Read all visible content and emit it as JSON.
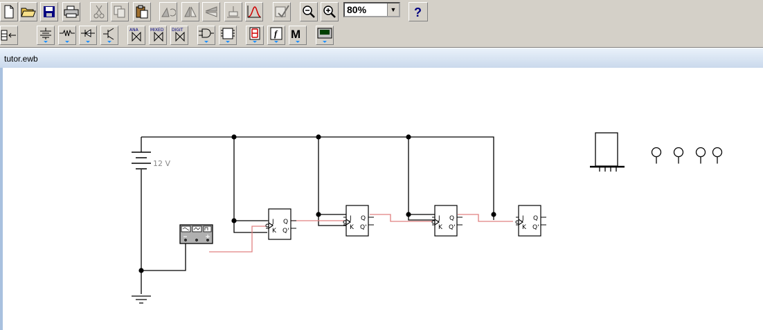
{
  "toolbar_main": {
    "zoom_value": "80%",
    "buttons": [
      "new-icon",
      "open-icon",
      "save-icon",
      "print-icon",
      "cut-icon",
      "copy-icon",
      "paste-icon",
      "rotate-icon",
      "flip-horizontal-icon",
      "flip-vertical-icon",
      "subcircuit-icon",
      "graph-icon",
      "component-properties-icon",
      "zoom-out-icon",
      "zoom-in-icon",
      "help-icon"
    ]
  },
  "toolbar_parts": {
    "m_label": "M",
    "f_label": "f",
    "ana_label": "ANA",
    "mixed_label": "MIXED",
    "digit_label": "DIGIT"
  },
  "window": {
    "title": "tutor.ewb"
  },
  "circuit": {
    "battery_label": "12 V",
    "flipflops": [
      {
        "j": "J",
        "k": "K",
        "q": "Q",
        "qn": "Q'"
      },
      {
        "j": "J",
        "k": "K",
        "q": "Q",
        "qn": "Q'"
      },
      {
        "j": "J",
        "k": "K",
        "q": "Q",
        "qn": "Q'"
      },
      {
        "j": "J",
        "k": "K",
        "q": "Q",
        "qn": "Q'"
      }
    ]
  }
}
